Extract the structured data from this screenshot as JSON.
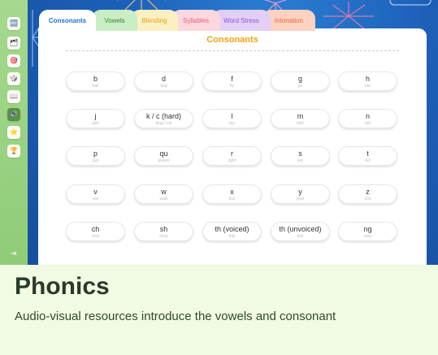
{
  "sidebar": {
    "items": [
      {
        "name": "sidebar-item-alphabet",
        "icon": "alphabet-icon",
        "glyph": "🔤",
        "active": false
      },
      {
        "name": "sidebar-item-words",
        "icon": "stack-icon",
        "glyph": "🗂",
        "active": false
      },
      {
        "name": "sidebar-item-practice",
        "icon": "target-icon",
        "glyph": "🎯",
        "active": false
      },
      {
        "name": "sidebar-item-games",
        "icon": "game-icon",
        "glyph": "🎲",
        "active": false
      },
      {
        "name": "sidebar-item-reading",
        "icon": "book-icon",
        "glyph": "📖",
        "active": false
      },
      {
        "name": "sidebar-item-phonics",
        "icon": "sound-icon",
        "glyph": "🔊",
        "active": true
      },
      {
        "name": "sidebar-item-rewards",
        "icon": "star-icon",
        "glyph": "⭐",
        "active": false
      },
      {
        "name": "sidebar-item-trophy",
        "icon": "trophy-icon",
        "glyph": "🏆",
        "active": false
      }
    ],
    "collapse_glyph": "⇥"
  },
  "tabs": [
    {
      "label": "Consonants",
      "bg": "#ffffff",
      "color": "#1e6fd1",
      "active": true
    },
    {
      "label": "Vowels",
      "bg": "#c9eec4",
      "color": "#3a7f33",
      "active": false
    },
    {
      "label": "Blending",
      "bg": "#fbf0c2",
      "color": "#e2a21a",
      "active": false
    },
    {
      "label": "Syllables",
      "bg": "#fbd7de",
      "color": "#e0607f",
      "active": false
    },
    {
      "label": "Word Stress",
      "bg": "#e2cff6",
      "color": "#8a55cf",
      "active": false
    },
    {
      "label": "Intonation",
      "bg": "#fdd2c1",
      "color": "#e2673a",
      "active": false
    }
  ],
  "panel": {
    "title": "Consonants"
  },
  "consonants": [
    {
      "symbol": "b",
      "example": "ball"
    },
    {
      "symbol": "d",
      "example": "dog"
    },
    {
      "symbol": "f",
      "example": "fly"
    },
    {
      "symbol": "g",
      "example": "go"
    },
    {
      "symbol": "h",
      "example": "hat"
    },
    {
      "symbol": "j",
      "example": "jam"
    },
    {
      "symbol": "k / c (hard)",
      "example": "king / cat"
    },
    {
      "symbol": "l",
      "example": "lay"
    },
    {
      "symbol": "m",
      "example": "milk"
    },
    {
      "symbol": "n",
      "example": "not"
    },
    {
      "symbol": "p",
      "example": "pat"
    },
    {
      "symbol": "qu",
      "example": "queen"
    },
    {
      "symbol": "r",
      "example": "right"
    },
    {
      "symbol": "s",
      "example": "sky"
    },
    {
      "symbol": "t",
      "example": "tell"
    },
    {
      "symbol": "v",
      "example": "van"
    },
    {
      "symbol": "w",
      "example": "walk"
    },
    {
      "symbol": "x",
      "example": "box"
    },
    {
      "symbol": "y",
      "example": "year"
    },
    {
      "symbol": "z",
      "example": "zoo"
    },
    {
      "symbol": "ch",
      "example": "chat"
    },
    {
      "symbol": "sh",
      "example": "shop"
    },
    {
      "symbol": "th (voiced)",
      "example": "this"
    },
    {
      "symbol": "th (unvoiced)",
      "example": "thin"
    },
    {
      "symbol": "ng",
      "example": "sing"
    }
  ],
  "caption": {
    "title": "Phonics",
    "description": "Audio-visual resources introduce the vowels and consonant"
  },
  "colors": {
    "accent": "#f3a114",
    "sky": "#1d5fb8",
    "sidebar": "#9fd488"
  }
}
